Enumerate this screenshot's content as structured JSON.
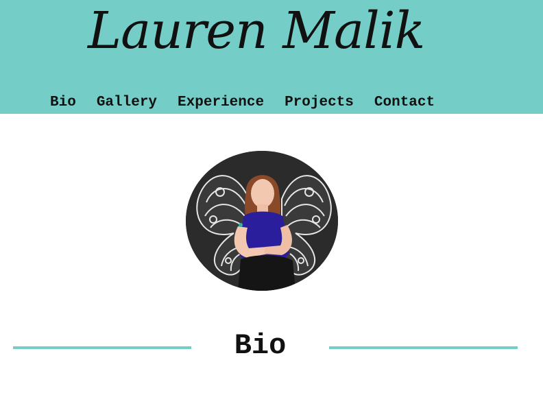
{
  "header": {
    "title": "Lauren Malik",
    "background_color": "#74cdc6"
  },
  "nav": {
    "items": [
      {
        "label": "Bio"
      },
      {
        "label": "Gallery"
      },
      {
        "label": "Experience"
      },
      {
        "label": "Projects"
      },
      {
        "label": "Contact"
      }
    ]
  },
  "profile": {
    "photo_icon": "profile-photo"
  },
  "section": {
    "title": "Bio",
    "divider_color": "#74cdc6"
  }
}
